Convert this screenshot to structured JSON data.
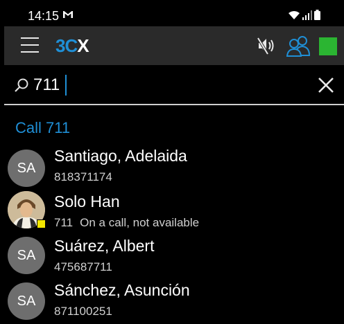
{
  "status_bar": {
    "time": "14:15",
    "mail_icon": "gmail-icon",
    "wifi_icon": "wifi-icon",
    "signal_icon": "signal-icon",
    "battery_icon": "battery-icon"
  },
  "app_bar": {
    "logo_main": "3C",
    "logo_x": "X",
    "menu_icon": "hamburger-menu-icon",
    "mute_icon": "speaker-muted-icon",
    "queue_icon": "queue-agents-icon",
    "status_color": "#2bb532"
  },
  "search": {
    "value": "711",
    "icon": "search-icon",
    "clear_icon": "close-icon"
  },
  "call_action": {
    "label": "Call 711"
  },
  "contacts": [
    {
      "initials": "SA",
      "name": "Santiago, Adelaida",
      "number": "818371174",
      "status": ""
    },
    {
      "initials": "",
      "name": "Solo Han",
      "number": "711",
      "status": "On a call, not available",
      "presence_color": "#f2e600"
    },
    {
      "initials": "SA",
      "name": "Suárez, Albert",
      "number": "475687711",
      "status": ""
    },
    {
      "initials": "SA",
      "name": "Sánchez, Asunción",
      "number": "871100251",
      "status": ""
    }
  ],
  "colors": {
    "accent": "#1f8fd6",
    "appbar": "#2a2a2a",
    "avatar": "#6e6e6e"
  }
}
